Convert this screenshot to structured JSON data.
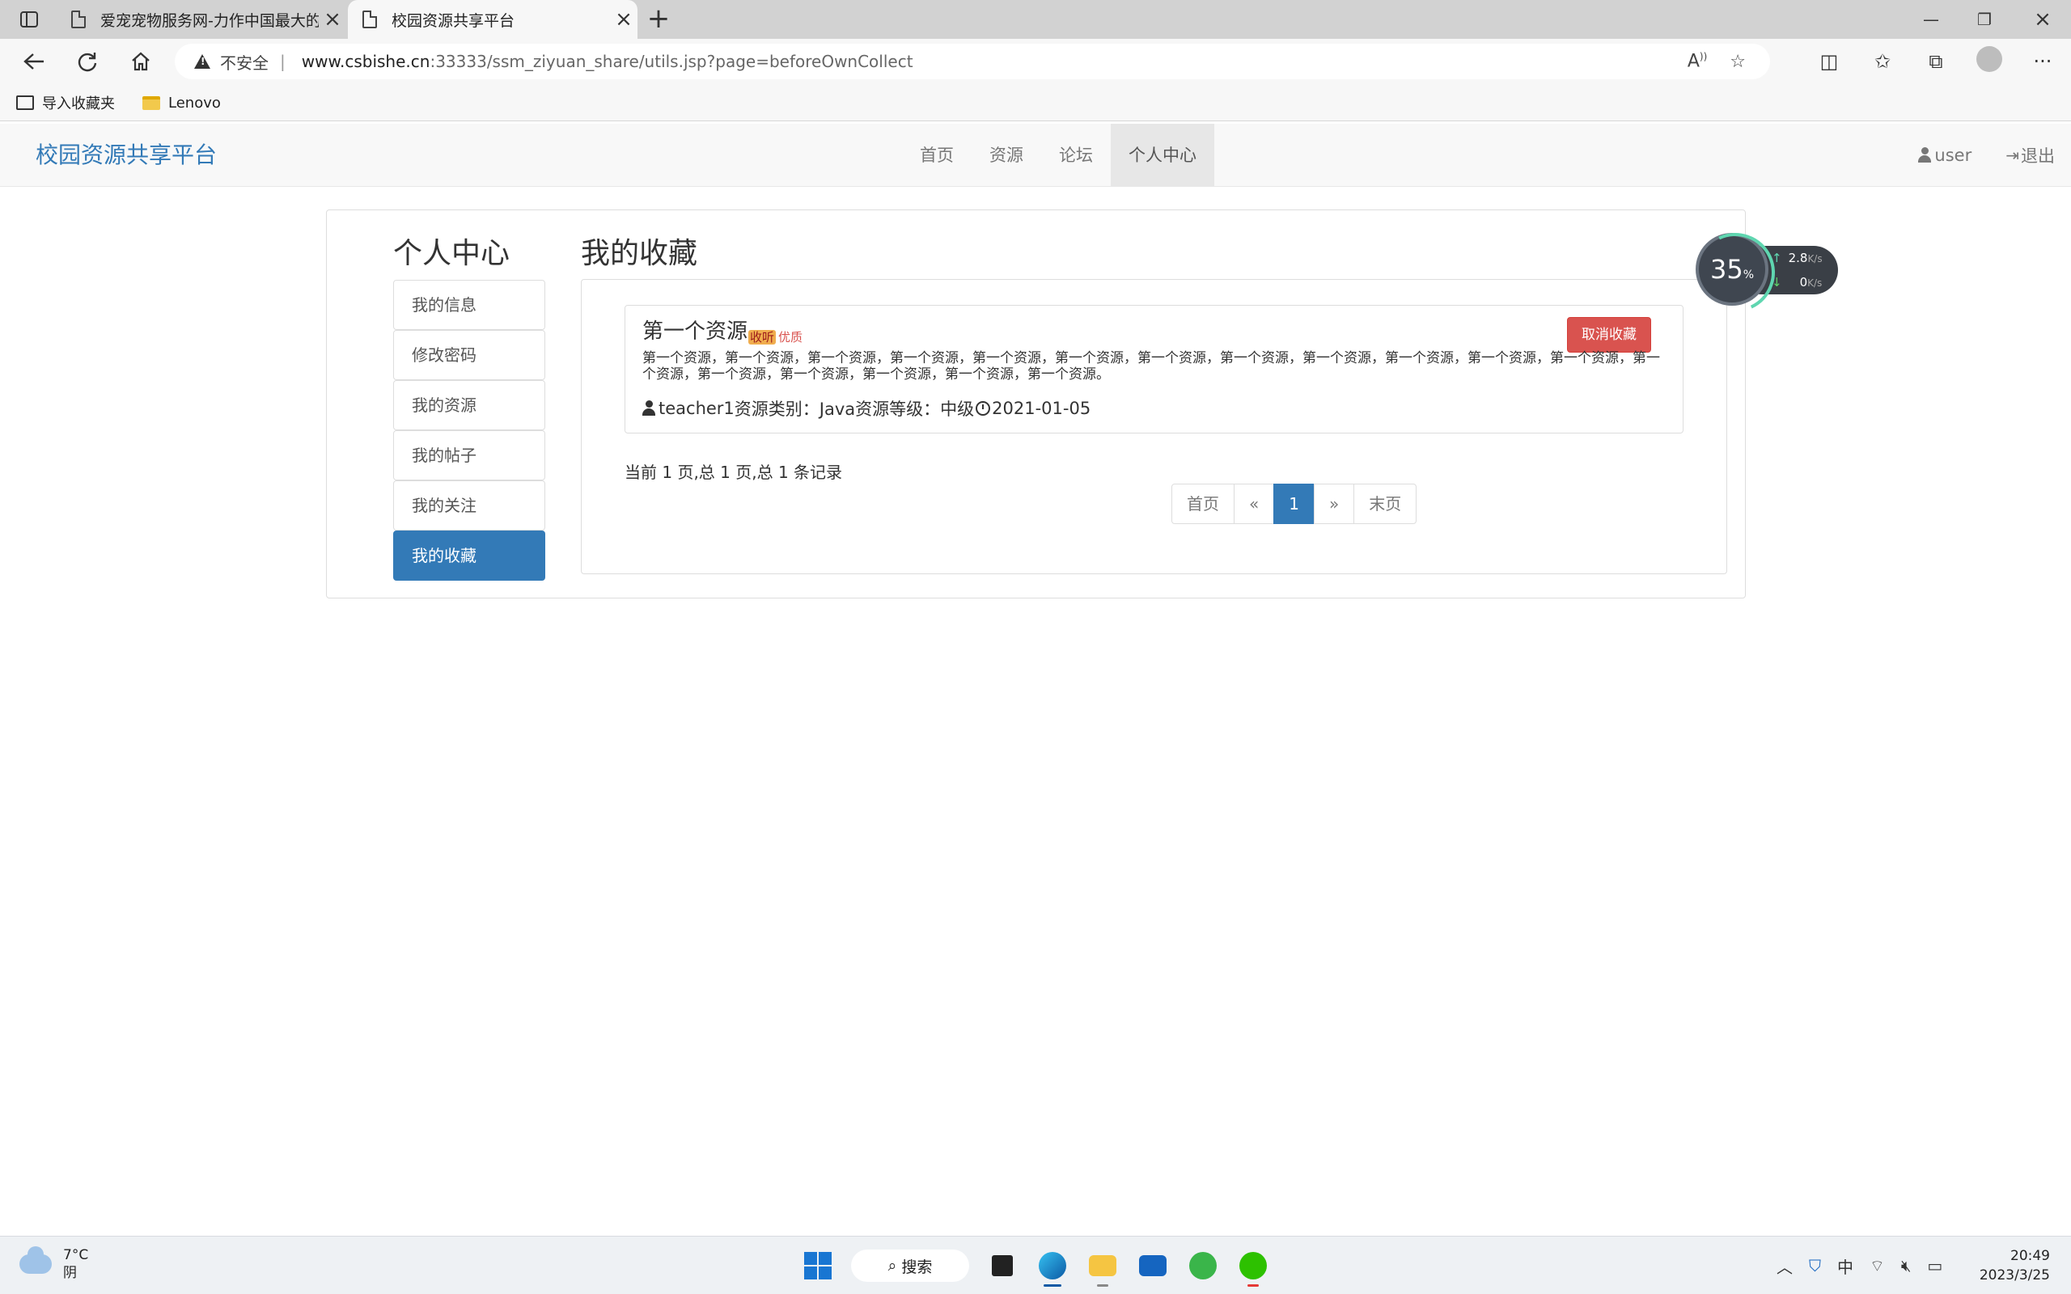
{
  "browser": {
    "tabs": [
      {
        "title": "爱宠宠物服务网-力作中国最大的",
        "active": false
      },
      {
        "title": "校园资源共享平台",
        "active": true
      }
    ],
    "address": {
      "security_label": "不安全",
      "host": "www.csbishe.cn",
      "path": ":33333/ssm_ziyuan_share/utils.jsp?page=beforeOwnCollect"
    },
    "favorites": [
      {
        "label": "导入收藏夹",
        "icon": "import-favorites-icon"
      },
      {
        "label": "Lenovo",
        "icon": "folder-icon"
      }
    ]
  },
  "site": {
    "brand": "校园资源共享平台",
    "menu": [
      "首页",
      "资源",
      "论坛",
      "个人中心"
    ],
    "active_menu": "个人中心",
    "user_label": "user",
    "logout_label": "退出"
  },
  "sidebar": {
    "title": "个人中心",
    "items": [
      "我的信息",
      "修改密码",
      "我的资源",
      "我的帖子",
      "我的关注",
      "我的收藏"
    ],
    "active_item": "我的收藏"
  },
  "main": {
    "title": "我的收藏",
    "resource": {
      "title": "第一个资源",
      "badge_1": "收听",
      "badge_2": "优质",
      "unfavorite_label": "取消收藏",
      "description": "第一个资源，第一个资源，第一个资源，第一个资源，第一个资源，第一个资源，第一个资源，第一个资源，第一个资源，第一个资源，第一个资源，第一个资源，第一个资源，第一个资源，第一个资源，第一个资源，第一个资源，第一个资源。",
      "author": "teacher1",
      "category": "资源类别：Java",
      "level": "资源等级：中级",
      "date": "2021-01-05"
    },
    "page_info": "当前 1 页,总 1 页,总 1 条记录",
    "pagination": [
      "首页",
      "«",
      "1",
      "»",
      "末页"
    ],
    "current_page": "1"
  },
  "speed_widget": {
    "percent": "35",
    "percent_unit": "%",
    "upload": "2.8",
    "download": "0",
    "unit": "K/s"
  },
  "taskbar": {
    "weather_temp": "7°C",
    "weather_desc": "阴",
    "search_label": "搜索",
    "time": "20:49",
    "date": "2023/3/25",
    "ime": "中"
  },
  "colors": {
    "primary": "#337ab7",
    "danger": "#d9534f",
    "navbar_bg": "#f8f8f8"
  }
}
